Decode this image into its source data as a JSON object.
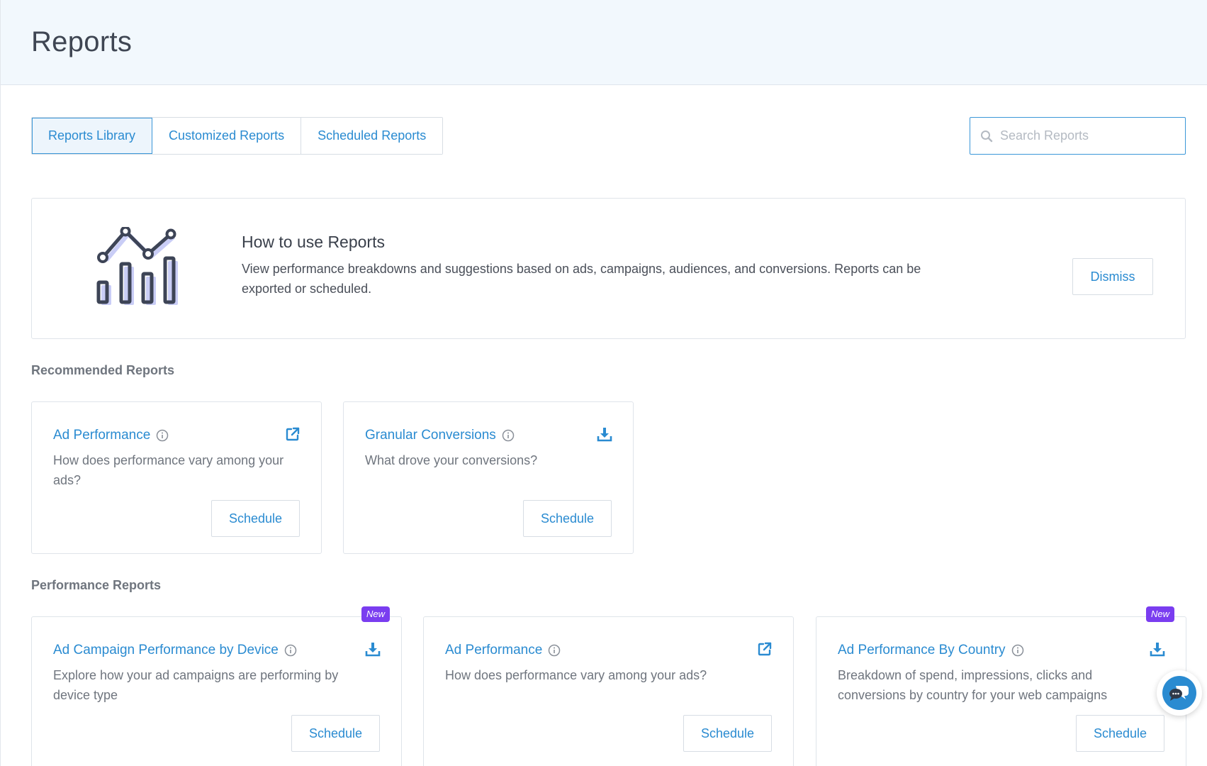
{
  "page": {
    "title": "Reports"
  },
  "tabs": [
    {
      "label": "Reports Library",
      "active": true
    },
    {
      "label": "Customized Reports",
      "active": false
    },
    {
      "label": "Scheduled Reports",
      "active": false
    }
  ],
  "search": {
    "placeholder": "Search Reports",
    "value": "",
    "icon": "search-icon"
  },
  "banner": {
    "title": "How to use Reports",
    "description": "View performance breakdowns and suggestions based on ads, campaigns, audiences, and conversions. Reports can be exported or scheduled.",
    "dismiss_label": "Dismiss",
    "illustration": "chart-illustration"
  },
  "recommended": {
    "heading": "Recommended Reports",
    "cards": [
      {
        "title": "Ad Performance",
        "description": "How does performance vary among your ads?",
        "action_icon": "external-link-icon",
        "schedule_label": "Schedule"
      },
      {
        "title": "Granular Conversions",
        "description": "What drove your conversions?",
        "action_icon": "download-icon",
        "schedule_label": "Schedule"
      }
    ]
  },
  "performance": {
    "heading": "Performance Reports",
    "cards": [
      {
        "title": "Ad Campaign Performance by Device",
        "description": "Explore how your ad campaigns are performing by device type",
        "action_icon": "download-icon",
        "schedule_label": "Schedule",
        "badge": "New"
      },
      {
        "title": "Ad Performance",
        "description": "How does performance vary among your ads?",
        "action_icon": "external-link-icon",
        "schedule_label": "Schedule"
      },
      {
        "title": "Ad Performance By Country",
        "description": "Breakdown of spend, impressions, clicks and conversions by country for your web campaigns",
        "action_icon": "download-icon",
        "schedule_label": "Schedule",
        "badge": "New"
      }
    ]
  },
  "colors": {
    "accent": "#2a8bd1",
    "header_bg": "#f2f8fd",
    "badge": "#7a3df0"
  },
  "chat": {
    "icon": "chat-icon"
  }
}
